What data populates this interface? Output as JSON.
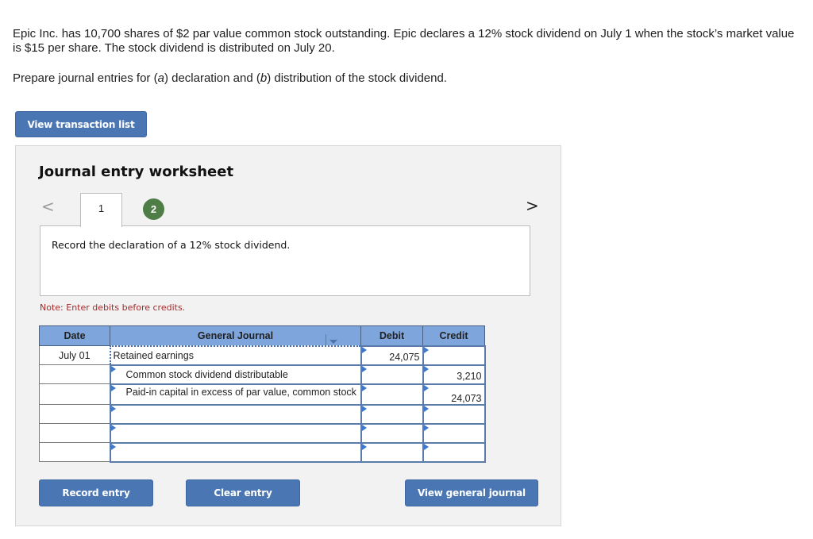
{
  "problem": {
    "paragraph1": "Epic Inc. has 10,700 shares of $2 par value common stock outstanding. Epic declares a 12% stock dividend on July 1 when the stock’s market value is $15 per share. The stock dividend is distributed on July 20.",
    "paragraph2_prefix": "Prepare journal entries for (",
    "paragraph2_a": "a",
    "paragraph2_mid": ") declaration and (",
    "paragraph2_b": "b",
    "paragraph2_suffix": ") distribution of the stock dividend."
  },
  "buttons": {
    "view_transaction_list": "View transaction list",
    "record_entry": "Record entry",
    "clear_entry": "Clear entry",
    "view_general_journal": "View general journal"
  },
  "worksheet": {
    "title": "Journal entry worksheet",
    "nav_prev": "<",
    "nav_next": ">",
    "tabs": [
      {
        "label": "1",
        "active": true
      },
      {
        "label": "2",
        "active": false,
        "color": "#4e7d46"
      }
    ],
    "instruction": "Record the declaration of a 12% stock dividend.",
    "note": "Note: Enter debits before credits."
  },
  "journal": {
    "headers": {
      "date": "Date",
      "general_journal": "General Journal",
      "debit": "Debit",
      "credit": "Credit"
    },
    "rows": [
      {
        "date": "July 01",
        "account": "Retained earnings",
        "debit": "24,075",
        "credit": ""
      },
      {
        "date": "",
        "account": "Common stock dividend distributable",
        "debit": "",
        "credit": "3,210"
      },
      {
        "date": "",
        "account": "Paid-in capital in excess of par value, common stock",
        "debit": "",
        "credit": "24,073"
      },
      {
        "date": "",
        "account": "",
        "debit": "",
        "credit": ""
      },
      {
        "date": "",
        "account": "",
        "debit": "",
        "credit": ""
      },
      {
        "date": "",
        "account": "",
        "debit": "",
        "credit": ""
      }
    ]
  },
  "colors": {
    "button_blue": "#4a76b4",
    "header_blue": "#7fa6dc",
    "note_red": "#a52a2a",
    "tab2_green": "#4e7d46"
  }
}
